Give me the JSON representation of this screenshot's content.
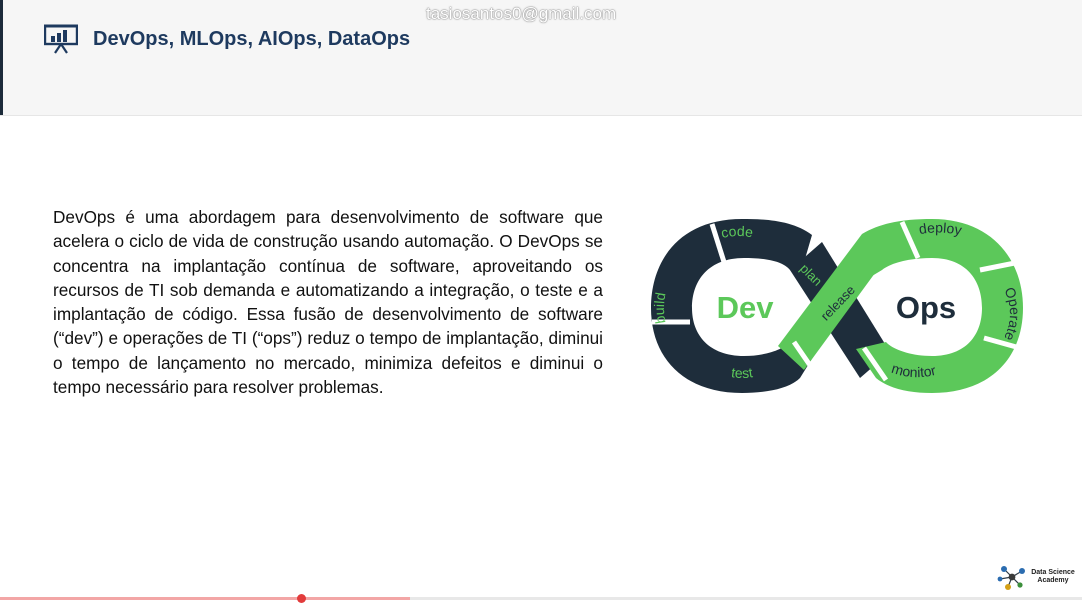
{
  "watermark": "tasiosantos0@gmail.com",
  "header": {
    "title": "DevOps, MLOps, AIOps, DataOps",
    "icon": "presentation-chart-icon"
  },
  "content": {
    "paragraph": "DevOps é uma abordagem para desenvolvimento de software que acelera o ciclo de vida de construção usando automação. O DevOps se concentra na implantação contínua de software, aproveitando os recursos de TI sob demanda e automatizando a integração, o teste e a implantação de código. Essa fusão de desenvolvimento de software (“dev”) e operações de TI (“ops”) reduz o tempo de implantação, diminui o tempo de lançamento no mercado, minimiza defeitos e diminui o tempo necessário para resolver problemas."
  },
  "diagram": {
    "dev_label": "Dev",
    "ops_label": "Ops",
    "stages": {
      "code": "code",
      "build": "build",
      "test": "test",
      "plan": "plan",
      "release": "release",
      "deploy": "deploy",
      "operate": "Operate",
      "monitor": "monitor"
    },
    "colors": {
      "dark": "#1e2d3b",
      "green": "#5cc85a",
      "white": "#ffffff"
    }
  },
  "footer": {
    "logo_line1": "Data Science",
    "logo_line2": "Academy",
    "slider_accent": "#e23b3b"
  }
}
